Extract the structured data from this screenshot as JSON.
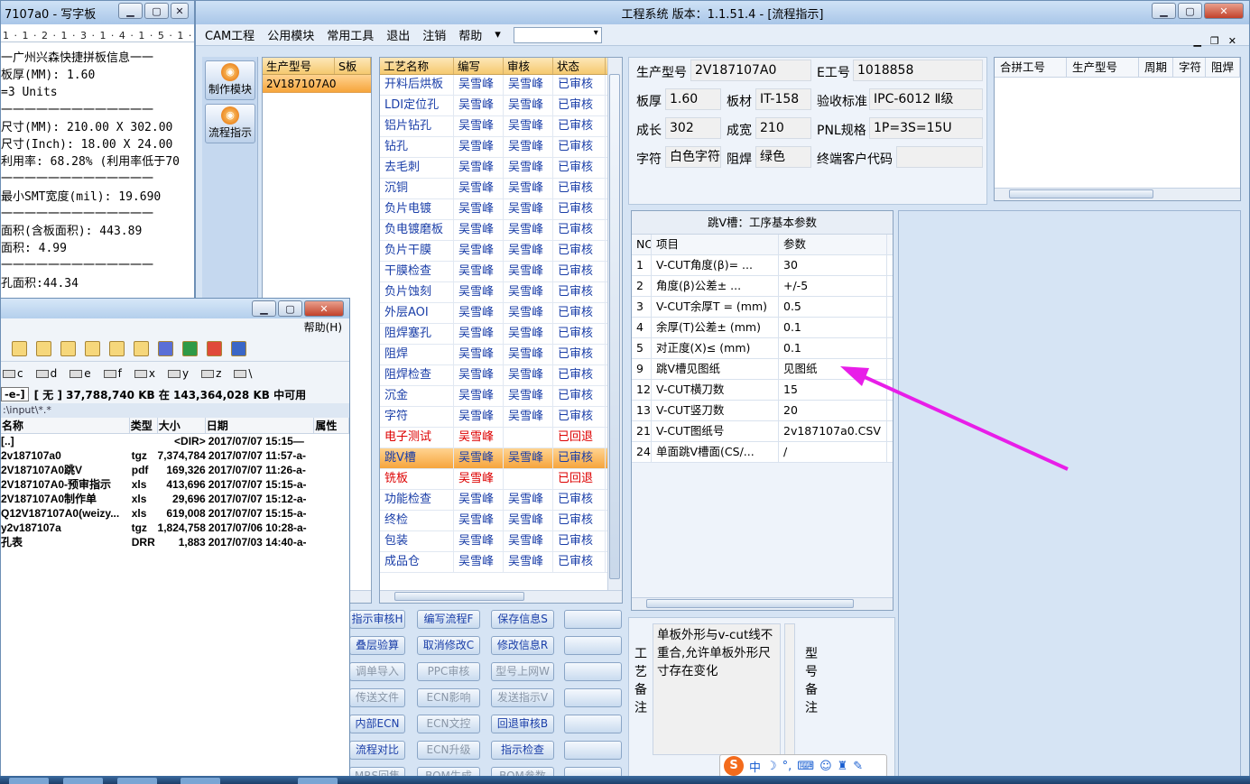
{
  "wordpad": {
    "title": "7107a0 - 写字板",
    "ruler": "1 · 1 · 2 · 1 · 3 · 1 · 4 · 1 · 5 · 1 · 6 ·",
    "lines": [
      "一广州兴森快捷拼板信息一一",
      "板厚(MM): 1.60",
      "=3 Units",
      "一一一一一一一一一一一一一",
      "尺寸(MM): 210.00 X 302.00",
      "尺寸(Inch): 18.00 X 24.00",
      "利用率: 68.28% (利用率低于70",
      "一一一一一一一一一一一一一",
      "最小SMT宽度(mil): 19.690",
      "一一一一一一一一一一一一一",
      "面积(含板面积): 443.89",
      "面积: 4.99",
      "一一一一一一一一一一一一一",
      "孔面积:44.34"
    ]
  },
  "main": {
    "title": "工程系统   版本：1.1.51.4 - [流程指示]",
    "menu": [
      "CAM工程",
      "公用模块",
      "常用工具",
      "退出",
      "注销",
      "帮助"
    ],
    "side_buttons": [
      "制作模块",
      "流程指示"
    ],
    "model_panel": {
      "headers": [
        "生产型号",
        "S板"
      ],
      "rows": [
        "2V187107A0"
      ]
    },
    "process_panel": {
      "headers": [
        "工艺名称",
        "编写",
        "审核",
        "状态"
      ],
      "rows": [
        [
          "开料后烘板",
          "吴雪峰",
          "吴雪峰",
          "已审核"
        ],
        [
          "LDI定位孔",
          "吴雪峰",
          "吴雪峰",
          "已审核"
        ],
        [
          "铝片钻孔",
          "吴雪峰",
          "吴雪峰",
          "已审核"
        ],
        [
          "钻孔",
          "吴雪峰",
          "吴雪峰",
          "已审核"
        ],
        [
          "去毛刺",
          "吴雪峰",
          "吴雪峰",
          "已审核"
        ],
        [
          "沉铜",
          "吴雪峰",
          "吴雪峰",
          "已审核"
        ],
        [
          "负片电镀",
          "吴雪峰",
          "吴雪峰",
          "已审核"
        ],
        [
          "负电镀磨板",
          "吴雪峰",
          "吴雪峰",
          "已审核"
        ],
        [
          "负片干膜",
          "吴雪峰",
          "吴雪峰",
          "已审核"
        ],
        [
          "干膜检查",
          "吴雪峰",
          "吴雪峰",
          "已审核"
        ],
        [
          "负片蚀刻",
          "吴雪峰",
          "吴雪峰",
          "已审核"
        ],
        [
          "外层AOI",
          "吴雪峰",
          "吴雪峰",
          "已审核"
        ],
        [
          "阻焊塞孔",
          "吴雪峰",
          "吴雪峰",
          "已审核"
        ],
        [
          "阻焊",
          "吴雪峰",
          "吴雪峰",
          "已审核"
        ],
        [
          "阻焊检查",
          "吴雪峰",
          "吴雪峰",
          "已审核"
        ],
        [
          "沉金",
          "吴雪峰",
          "吴雪峰",
          "已审核"
        ],
        [
          "字符",
          "吴雪峰",
          "吴雪峰",
          "已审核"
        ],
        [
          "电子测试",
          "吴雪峰",
          "",
          "已回退"
        ],
        [
          "跳V槽",
          "吴雪峰",
          "吴雪峰",
          "已审核"
        ],
        [
          "铣板",
          "吴雪峰",
          "",
          "已回退"
        ],
        [
          "功能检查",
          "吴雪峰",
          "吴雪峰",
          "已审核"
        ],
        [
          "终检",
          "吴雪峰",
          "吴雪峰",
          "已审核"
        ],
        [
          "包装",
          "吴雪峰",
          "吴雪峰",
          "已审核"
        ],
        [
          "成品仓",
          "吴雪峰",
          "吴雪峰",
          "已审核"
        ]
      ],
      "selected_row": 18
    },
    "info": {
      "model_label": "生产型号",
      "model_value": "2V187107A0",
      "e_label": "E工号",
      "e_value": "1018858",
      "thick_label": "板厚",
      "thick_value": "1.60",
      "mat_label": "板材",
      "mat_value": "IT-158",
      "std_label": "验收标准",
      "std_value": "IPC-6012 Ⅱ级",
      "len_label": "成长",
      "len_value": "302",
      "wid_label": "成宽",
      "wid_value": "210",
      "pnl_label": "PNL规格",
      "pnl_value": "1P=3S=15U",
      "char_label": "字符",
      "char_value": "白色字符",
      "mask_label": "阻焊",
      "mask_value": "绿色",
      "cust_label": "终端客户代码",
      "cust_value": ""
    },
    "merge_panel": {
      "headers": [
        "合拼工号",
        "生产型号",
        "周期",
        "字符",
        "阻焊"
      ]
    },
    "params": {
      "title": "跳V槽：工序基本参数",
      "headers": [
        "NO",
        "项目",
        "参数"
      ],
      "rows": [
        [
          "1",
          "V-CUT角度(β)=  ...",
          "30"
        ],
        [
          "2",
          "角度(β)公差±  ...",
          "+/-5"
        ],
        [
          "3",
          "V-CUT余厚T =  (mm)",
          "0.5"
        ],
        [
          "4",
          "余厚(T)公差±  (mm)",
          "0.1"
        ],
        [
          "5",
          "对正度(X)≤ (mm)",
          "0.1"
        ],
        [
          "9",
          "跳V槽见图纸",
          "见图纸"
        ],
        [
          "12",
          "V-CUT横刀数",
          "15"
        ],
        [
          "13",
          "V-CUT竖刀数",
          "20"
        ],
        [
          "21",
          "V-CUT图纸号",
          "2v187107a0.CSV"
        ],
        [
          "24",
          "单面跳V槽面(CS/...",
          "/"
        ]
      ]
    },
    "remarks": {
      "craft_label": "工艺备注",
      "craft_text": "单板外形与v-cut线不重合,允许单板外形尺寸存在变化",
      "model_label": "型号备注"
    },
    "buttons": [
      [
        "指示审核H",
        "编写流程F",
        "保存信息S",
        ""
      ],
      [
        "叠层验算",
        "取消修改C",
        "修改信息R",
        ""
      ],
      [
        "调单导入",
        "PPC审核",
        "型号上网W",
        ""
      ],
      [
        "传送文件",
        "ECN影响",
        "发送指示V",
        ""
      ],
      [
        "内部ECN",
        "ECN文控",
        "回退审核B",
        ""
      ],
      [
        "流程对比",
        "ECN升级",
        "指示检查",
        ""
      ],
      [
        "MRS回售",
        "BOM生成",
        "BOM参数",
        ""
      ]
    ],
    "disabled_buttons": [
      "调单导入",
      "PPC审核",
      "型号上网W",
      "传送文件",
      "ECN影响",
      "发送指示V",
      "ECN文控",
      "ECN升级",
      "MRS回售",
      "BOM生成",
      "BOM参数"
    ]
  },
  "filemgr": {
    "menu_help": "帮助(H)",
    "drives": [
      "c",
      "d",
      "e",
      "f",
      "x",
      "y",
      "z",
      "\\"
    ],
    "drive_select": "-e-]",
    "status": "[ 无 ]  37,788,740 KB 在 143,364,028 KB 中可用",
    "path": ":\\input\\*.*",
    "headers": [
      "名称",
      "类型",
      "大小",
      "日期",
      "属性"
    ],
    "files": [
      [
        "[..]",
        "",
        "<DIR>",
        "2017/07/07 15:15—",
        ""
      ],
      [
        "2v187107a0",
        "tgz",
        "7,374,784",
        "2017/07/07 11:57-a-",
        ""
      ],
      [
        "2V187107A0跳V",
        "pdf",
        "169,326",
        "2017/07/07 11:26-a-",
        ""
      ],
      [
        "2V187107A0-预审指示",
        "xls",
        "413,696",
        "2017/07/07 15:15-a-",
        ""
      ],
      [
        "2V187107A0制作单",
        "xls",
        "29,696",
        "2017/07/07 15:12-a-",
        ""
      ],
      [
        "Q12V187107A0(weizy...",
        "xls",
        "619,008",
        "2017/07/07 15:15-a-",
        ""
      ],
      [
        "y2v187107a",
        "tgz",
        "1,824,758",
        "2017/07/06 10:28-a-",
        ""
      ],
      [
        "孔表",
        "DRR",
        "1,883",
        "2017/07/03 14:40-a-",
        ""
      ]
    ]
  },
  "ime": {
    "lang": "中"
  },
  "colors": {
    "accent_arrow": "#e81ee8",
    "selected_row": "#f6a53c",
    "link_text": "#1a3ea8",
    "rollback_text": "#dd0000"
  }
}
